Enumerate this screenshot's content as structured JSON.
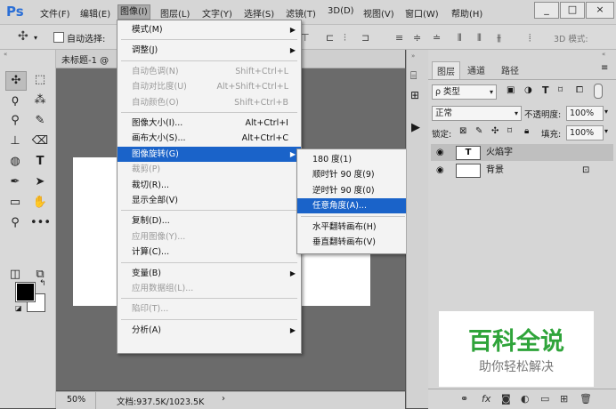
{
  "app": {
    "logo": "Ps"
  },
  "menubar": {
    "items": [
      "文件(F)",
      "编辑(E)",
      "图像(I)",
      "图层(L)",
      "文字(Y)",
      "选择(S)",
      "滤镜(T)",
      "3D(D)",
      "视图(V)",
      "窗口(W)",
      "帮助(H)"
    ],
    "active_item": "图像(I)",
    "window_buttons": [
      "_",
      "□",
      "×"
    ]
  },
  "optionsbar": {
    "auto_select_label": "自动选择:",
    "mode_3d_label": "3D 模式:"
  },
  "document": {
    "tab_title": "未标题-1 @",
    "zoom": "50%",
    "doc_size": "文档:937.5K/1023.5K",
    "status_arrow": "›"
  },
  "image_menu": {
    "items": [
      {
        "label": "模式(M)",
        "shortcut": "",
        "submenu": true,
        "disabled": false
      },
      {
        "sep": true
      },
      {
        "label": "调整(J)",
        "shortcut": "",
        "submenu": true,
        "disabled": false
      },
      {
        "sep": true
      },
      {
        "label": "自动色调(N)",
        "shortcut": "Shift+Ctrl+L",
        "submenu": false,
        "disabled": true
      },
      {
        "label": "自动对比度(U)",
        "shortcut": "Alt+Shift+Ctrl+L",
        "submenu": false,
        "disabled": true
      },
      {
        "label": "自动颜色(O)",
        "shortcut": "Shift+Ctrl+B",
        "submenu": false,
        "disabled": true
      },
      {
        "sep": true
      },
      {
        "label": "图像大小(I)...",
        "shortcut": "Alt+Ctrl+I",
        "submenu": false,
        "disabled": false
      },
      {
        "label": "画布大小(S)...",
        "shortcut": "Alt+Ctrl+C",
        "submenu": false,
        "disabled": false
      },
      {
        "label": "图像旋转(G)",
        "shortcut": "",
        "submenu": true,
        "disabled": false,
        "highlighted": true
      },
      {
        "label": "裁剪(P)",
        "shortcut": "",
        "submenu": false,
        "disabled": true
      },
      {
        "label": "裁切(R)...",
        "shortcut": "",
        "submenu": false,
        "disabled": false
      },
      {
        "label": "显示全部(V)",
        "shortcut": "",
        "submenu": false,
        "disabled": false
      },
      {
        "sep": true
      },
      {
        "label": "复制(D)...",
        "shortcut": "",
        "submenu": false,
        "disabled": false
      },
      {
        "label": "应用图像(Y)...",
        "shortcut": "",
        "submenu": false,
        "disabled": true
      },
      {
        "label": "计算(C)...",
        "shortcut": "",
        "submenu": false,
        "disabled": false
      },
      {
        "sep": true
      },
      {
        "label": "变量(B)",
        "shortcut": "",
        "submenu": true,
        "disabled": false
      },
      {
        "label": "应用数据组(L)...",
        "shortcut": "",
        "submenu": false,
        "disabled": true
      },
      {
        "sep": true
      },
      {
        "label": "陷印(T)...",
        "shortcut": "",
        "submenu": false,
        "disabled": true
      },
      {
        "sep": true
      },
      {
        "label": "分析(A)",
        "shortcut": "",
        "submenu": true,
        "disabled": false
      }
    ]
  },
  "rotate_submenu": {
    "items": [
      {
        "label": "180 度(1)",
        "highlighted": false
      },
      {
        "label": "顺时针 90 度(9)",
        "highlighted": false
      },
      {
        "label": "逆时针 90 度(0)",
        "highlighted": false
      },
      {
        "label": "任意角度(A)...",
        "highlighted": true
      },
      {
        "sep": true
      },
      {
        "label": "水平翻转画布(H)",
        "highlighted": false
      },
      {
        "label": "垂直翻转画布(V)",
        "highlighted": false
      }
    ]
  },
  "layers_panel": {
    "tabs": [
      "图层",
      "通道",
      "路径"
    ],
    "active_tab": "图层",
    "filter_label": "ρ 类型",
    "blend_mode": "正常",
    "opacity_label": "不透明度:",
    "opacity_value": "100%",
    "lock_label": "锁定:",
    "fill_label": "填充:",
    "fill_value": "100%",
    "layers": [
      {
        "name": "火焰字",
        "type": "text",
        "thumb": "T",
        "selected": true
      },
      {
        "name": "背景",
        "type": "background",
        "thumb": "",
        "selected": false
      }
    ]
  },
  "watermark": {
    "title": "百科全说",
    "subtitle": "助你轻松解决"
  },
  "colors": {
    "highlight": "#1a63c9",
    "watermark_green": "#2fa43a"
  }
}
